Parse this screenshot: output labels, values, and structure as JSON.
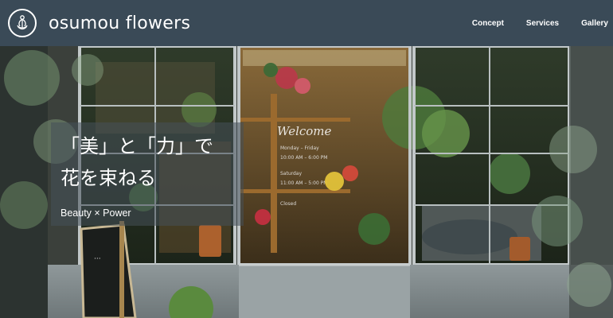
{
  "header": {
    "brand": "osumou flowers",
    "nav": [
      {
        "label": "Concept"
      },
      {
        "label": "Services"
      },
      {
        "label": "Gallery"
      }
    ]
  },
  "hero": {
    "catch_line_1": "「美」と「力」で",
    "catch_line_2": "花を束ねる",
    "subline": "Beauty × Power",
    "window_sign": {
      "title": "Welcome",
      "hours": [
        "Monday – Friday",
        "10:00 AM – 6:00 PM",
        "Saturday",
        "11:00 AM – 5:00 PM",
        "Closed"
      ]
    }
  },
  "colors": {
    "header_bg": "#3a4a57",
    "overlay_bg": "rgba(70,80,90,0.55)",
    "text": "#ffffff"
  }
}
